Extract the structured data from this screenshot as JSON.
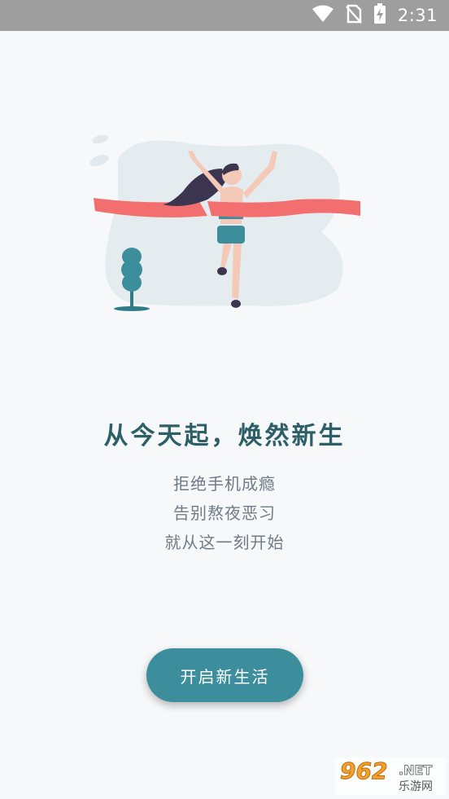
{
  "status_bar": {
    "time": "2:31",
    "icons": [
      "wifi-icon",
      "no-sim-icon",
      "battery-charging-icon"
    ],
    "background": "#9e9e9e"
  },
  "main": {
    "headline": "从今天起，焕然新生",
    "lines": [
      "拒绝手机成瘾",
      "告别熬夜恶习",
      "就从这一刻开始"
    ],
    "button_label": "开启新生活"
  },
  "watermark": {
    "number": "962",
    "suffix": ".NET",
    "site": "乐游网"
  },
  "colors": {
    "accent": "#3d8e9c",
    "headline": "#2c5f67",
    "ribbon": "#f36f6f",
    "text_muted": "#6f7b87"
  }
}
